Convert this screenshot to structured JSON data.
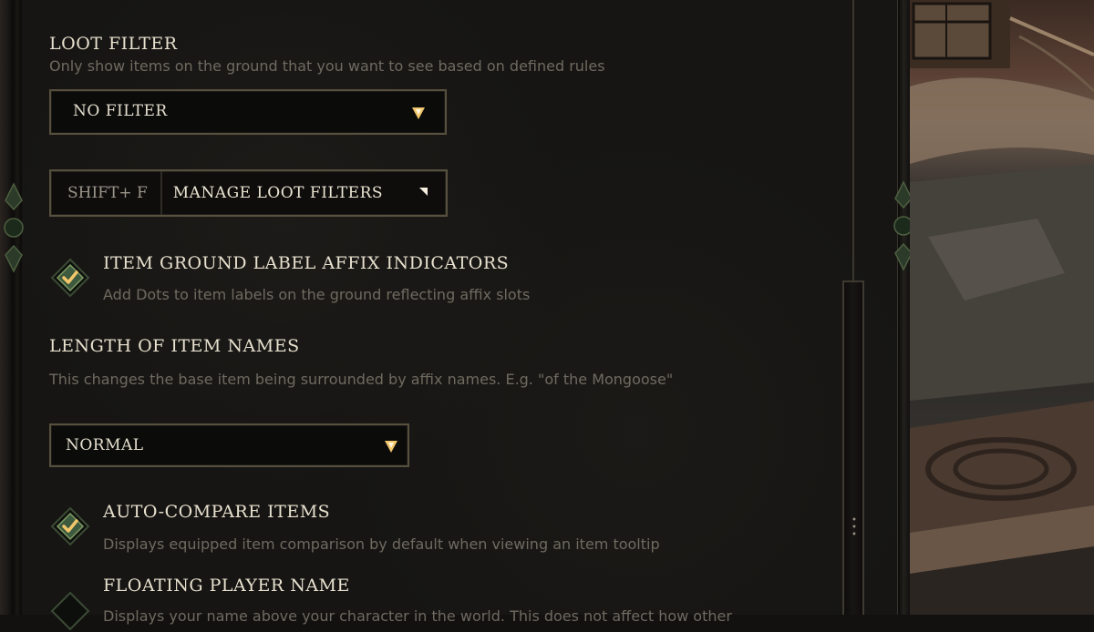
{
  "loot_filter": {
    "heading": "LOOT FILTER",
    "description": "Only show items on the ground that you want to see based on defined rules",
    "selected": "NO FILTER"
  },
  "manage_button": {
    "key": "SHIFT+ F",
    "label": "MANAGE LOOT FILTERS"
  },
  "affix_indicators": {
    "heading": "ITEM GROUND LABEL AFFIX INDICATORS",
    "description": "Add Dots to item labels on the ground reflecting affix slots",
    "checked": true
  },
  "item_names": {
    "heading": "LENGTH OF ITEM NAMES",
    "description": "This changes the base item being surrounded by affix names. E.g. \"of the Mongoose\"",
    "selected": "NORMAL"
  },
  "auto_compare": {
    "heading": "AUTO-COMPARE ITEMS",
    "description": "Displays equipped item comparison by default when viewing an item tooltip",
    "checked": true
  },
  "floating_name": {
    "heading": "FLOATING PLAYER NAME",
    "description": "Displays your name above your character in the world. This does not affect how other",
    "checked": false
  },
  "colors": {
    "accent_gold": "#f2c66a",
    "check_green": "#3d5a3e"
  }
}
